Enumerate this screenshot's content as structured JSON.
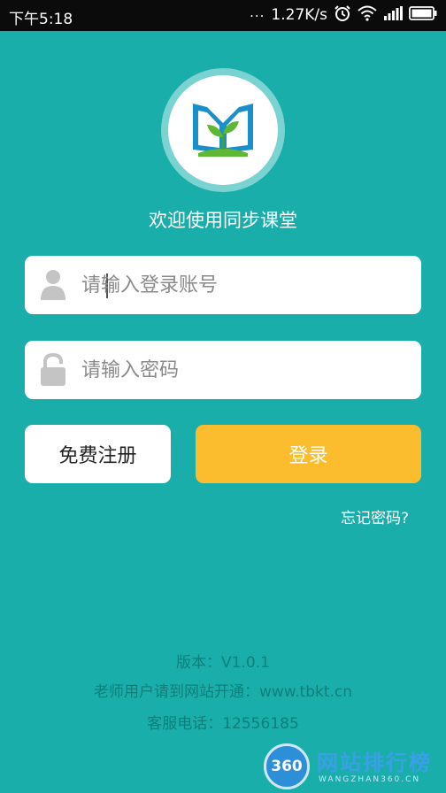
{
  "status_bar": {
    "time": "下午5:18",
    "dots": "...",
    "net_speed": "1.27K/s",
    "icons": [
      "alarm-icon",
      "wifi-icon",
      "signal-icon",
      "battery-icon"
    ]
  },
  "app": {
    "welcome": "欢迎使用同步课堂",
    "username": {
      "value": "",
      "placeholder": "请输入登录账号"
    },
    "password": {
      "value": "",
      "placeholder": "请输入密码"
    },
    "register_label": "免费注册",
    "login_label": "登录",
    "forgot_label": "忘记密码?"
  },
  "footer": {
    "version": "版本：V1.0.1",
    "site": "老师用户请到网站开通：www.tbkt.cn",
    "phone": "客服电话：12556185"
  },
  "watermark": {
    "badge": "360",
    "title": "网站排行榜",
    "subtitle": "WANGZHAN360.CN"
  },
  "colors": {
    "background": "#1aaeaa",
    "login_button": "#fbbd2e",
    "status_bar": "#0b0b0b",
    "footer_text": "#0e7f7b"
  }
}
